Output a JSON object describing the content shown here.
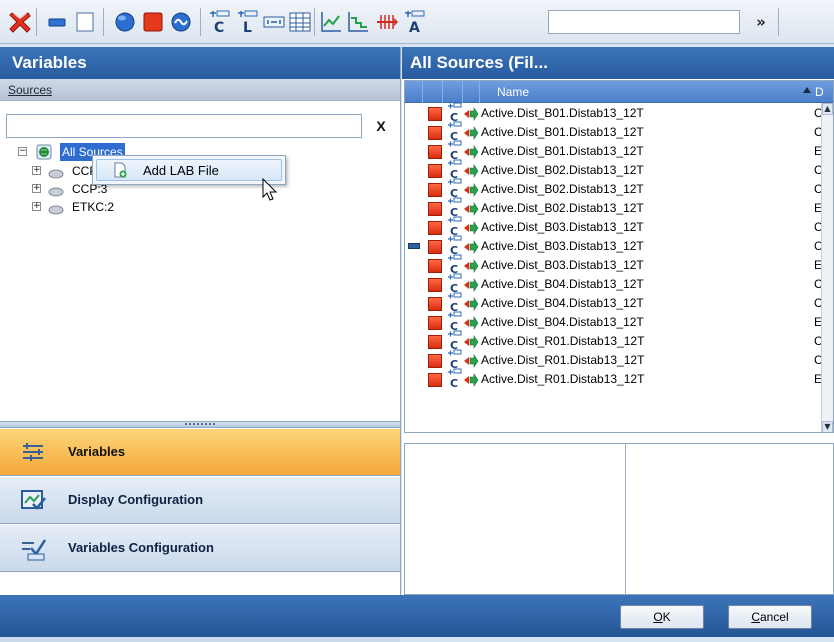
{
  "left_panel": {
    "title": "Variables",
    "sources_header": "Sources",
    "search_value": "",
    "clear_label": "X",
    "tree": [
      {
        "label": "All Sources",
        "expanded": true
      },
      {
        "label": "CCP:1"
      },
      {
        "label": "CCP:3"
      },
      {
        "label": "ETKC:2"
      }
    ],
    "context_menu": {
      "item": "Add LAB File"
    },
    "nav": [
      {
        "label": "Variables",
        "active": true
      },
      {
        "label": "Display Configuration"
      },
      {
        "label": "Variables Configuration"
      }
    ]
  },
  "right_panel": {
    "title": "All Sources (Fil...",
    "columns": {
      "name": "Name",
      "d": "D"
    },
    "rows": [
      {
        "name": "Active.Dist_B01.Distab13_12T",
        "d": "C"
      },
      {
        "name": "Active.Dist_B01.Distab13_12T",
        "d": "C"
      },
      {
        "name": "Active.Dist_B01.Distab13_12T",
        "d": "E"
      },
      {
        "name": "Active.Dist_B02.Distab13_12T",
        "d": "C"
      },
      {
        "name": "Active.Dist_B02.Distab13_12T",
        "d": "C"
      },
      {
        "name": "Active.Dist_B02.Distab13_12T",
        "d": "E"
      },
      {
        "name": "Active.Dist_B03.Distab13_12T",
        "d": "C"
      },
      {
        "name": "Active.Dist_B03.Distab13_12T",
        "d": "C",
        "selected": true
      },
      {
        "name": "Active.Dist_B03.Distab13_12T",
        "d": "E"
      },
      {
        "name": "Active.Dist_B04.Distab13_12T",
        "d": "C"
      },
      {
        "name": "Active.Dist_B04.Distab13_12T",
        "d": "C"
      },
      {
        "name": "Active.Dist_B04.Distab13_12T",
        "d": "E"
      },
      {
        "name": "Active.Dist_R01.Distab13_12T",
        "d": "C"
      },
      {
        "name": "Active.Dist_R01.Distab13_12T",
        "d": "C"
      },
      {
        "name": "Active.Dist_R01.Distab13_12T",
        "d": "E"
      }
    ]
  },
  "footer": {
    "ok": "OK",
    "cancel": "Cancel"
  },
  "icons": {
    "toolbar": [
      "delete-icon",
      "rectangle-blue-icon",
      "empty-rectangle-icon",
      "circle-icon",
      "red-square-icon",
      "wave-icon",
      "calibration-c-icon",
      "calibration-l-icon",
      "bracket-icon",
      "table-icon",
      "line-chart-icon",
      "step-chart-icon",
      "bar-chart-icon",
      "text-a-icon",
      "chevron-double-down-icon"
    ]
  },
  "colors": {
    "accent": "#275a9e",
    "active_nav": "#f5a83a",
    "row_square": "#e8401c"
  }
}
